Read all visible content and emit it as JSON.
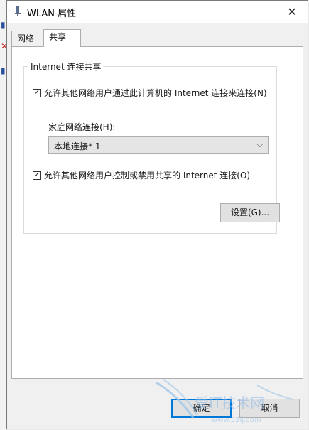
{
  "window": {
    "title": "WLAN 属性",
    "close_glyph": "✕"
  },
  "tabs": [
    {
      "label": "网络",
      "active": false
    },
    {
      "label": "共享",
      "active": true
    }
  ],
  "group": {
    "title": "Internet 连接共享",
    "allow_share": {
      "label": "允许其他网络用户通过此计算机的 Internet 连接来连接(N)",
      "checked": true
    },
    "home_network": {
      "label": "家庭网络连接(H):",
      "selected": "本地连接* 1"
    },
    "allow_control": {
      "label": "允许其他网络用户控制或禁用共享的 Internet 连接(O)",
      "checked": true
    },
    "settings_label": "设置(G)..."
  },
  "footer": {
    "ok_label": "确定",
    "cancel_label": "取消"
  },
  "watermark": {
    "text": "爱IT技术网",
    "url": "www.52ij.com"
  },
  "colors": {
    "accent": "#0078d7",
    "window_bg": "#f0f0f0",
    "panel_bg": "#ffffff"
  },
  "icons": {
    "title": "wlan-antenna-icon",
    "check": "checkmark-icon",
    "dropdown": "chevron-down-icon",
    "close": "close-icon"
  }
}
